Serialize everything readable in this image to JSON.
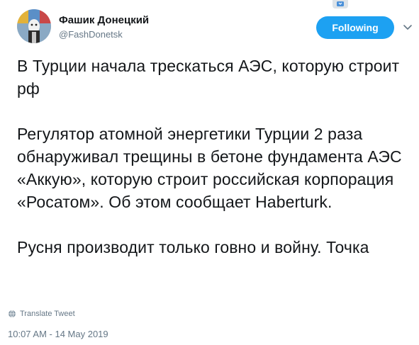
{
  "user": {
    "display_name": "Фашик Донецкий",
    "handle": "@FashDonetsk"
  },
  "actions": {
    "follow_label": "Following",
    "more_icon": "chevron-down-icon"
  },
  "tweet": {
    "paragraphs": [
      "В Турции начала трескаться АЭС, которую строит рф",
      "Регулятор атомной энергетики Турции 2 раза обнаруживал трещины в бетоне фундамента АЭС «Аккую», которую строит российская корпорация «Росатом». Об этом сообщает Haberturk.",
      "Русня производит только говно и войну. Точка"
    ],
    "translate_label": "Translate Tweet",
    "timestamp": "10:07 AM - 14 May 2019"
  },
  "colors": {
    "accent": "#1da1f2",
    "text": "#14171a",
    "secondary": "#657786"
  }
}
